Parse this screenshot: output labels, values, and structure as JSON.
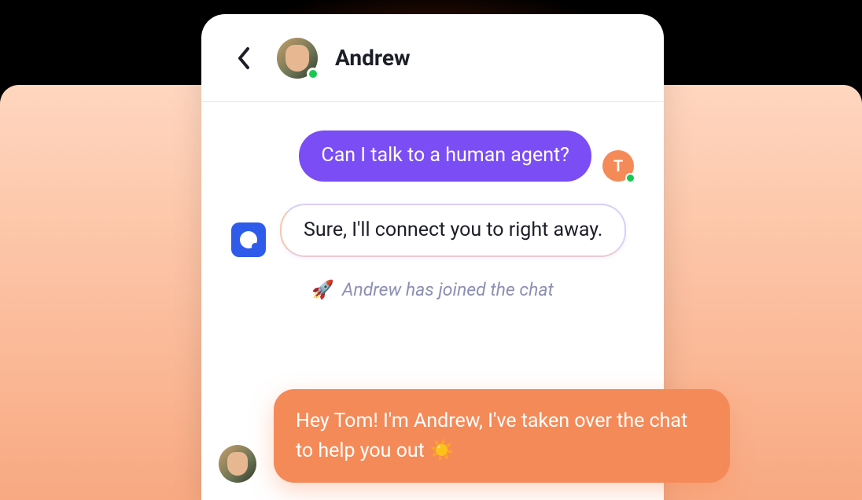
{
  "header": {
    "name": "Andrew"
  },
  "messages": {
    "user1": "Can I talk to a human agent?",
    "bot1": "Sure, I'll connect you to right away.",
    "system_emoji": "🚀",
    "system_text": "Andrew has joined the chat",
    "agent1": "Hey Tom! I'm Andrew,  I've taken over the chat to help you out ☀️"
  },
  "user_avatar_letter": "T"
}
